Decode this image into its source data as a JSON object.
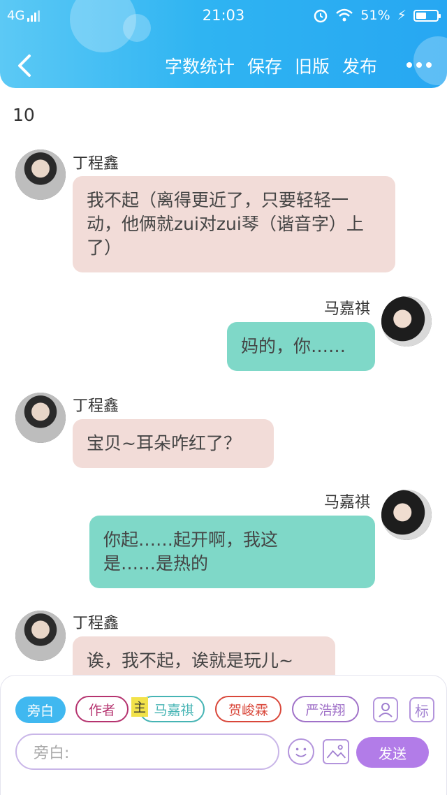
{
  "status_bar": {
    "network": "4G",
    "time": "21:03",
    "battery_percent": "51%",
    "battery_level": 0.51
  },
  "nav": {
    "back_icon": "chevron-left-icon",
    "word_count": "字数统计",
    "save": "保存",
    "old_version": "旧版",
    "publish": "发布",
    "more_icon": "more-dots-icon"
  },
  "chapter_number": "10",
  "messages": [
    {
      "speaker": "丁程鑫",
      "side": "left",
      "text": "我不起（离得更近了，只要轻轻一动，他俩就zui对zui琴（谐音字）上了）"
    },
    {
      "speaker": "马嘉祺",
      "side": "right",
      "text": "妈的，你……"
    },
    {
      "speaker": "丁程鑫",
      "side": "left",
      "text": "宝贝~耳朵咋红了？"
    },
    {
      "speaker": "马嘉祺",
      "side": "right",
      "text": "你起……起开啊，我这是……是热的"
    },
    {
      "speaker": "丁程鑫",
      "side": "left",
      "text": "诶，我不起，诶就是玩儿~"
    }
  ],
  "roles": {
    "narration": "旁白",
    "author": "作者",
    "main_tag": "主",
    "ma": "马嘉祺",
    "he": "贺峻霖",
    "yan": "严浩翔",
    "tag_btn": "标"
  },
  "input": {
    "placeholder": "旁白:",
    "send": "发送"
  },
  "colors": {
    "header": "#2fb4f2",
    "left_bubble": "#f2dcd8",
    "right_bubble": "#7fd8c8",
    "send_button": "#b27ce8"
  }
}
